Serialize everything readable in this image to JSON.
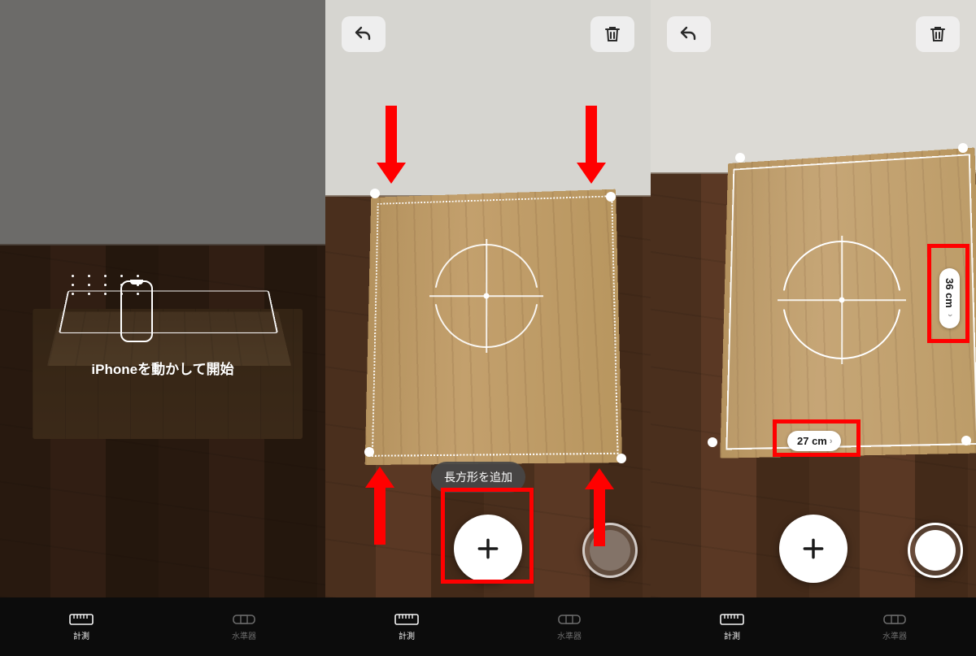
{
  "panel1": {
    "instruction": "iPhoneを動かして開始"
  },
  "panel2": {
    "tooltip": "長方形を追加"
  },
  "panel3": {
    "measure_width": "27 cm",
    "measure_height": "36 cm"
  },
  "tabs": {
    "measure": "計測",
    "level": "水準器"
  },
  "icons": {
    "undo": "undo-icon",
    "trash": "trash-icon",
    "plus": "plus-icon",
    "ruler": "ruler-icon",
    "level": "level-icon"
  }
}
